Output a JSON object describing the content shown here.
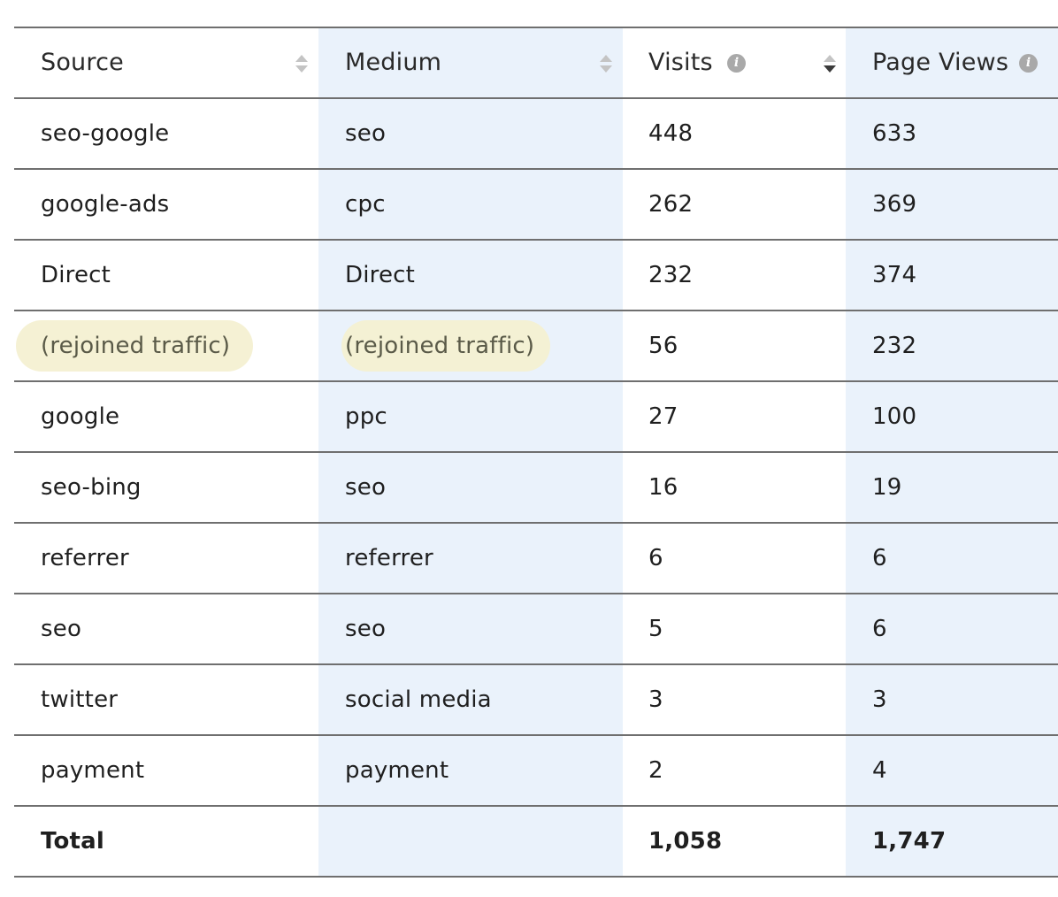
{
  "columns": {
    "source": "Source",
    "medium": "Medium",
    "visits": "Visits",
    "page_views": "Page Views"
  },
  "rows": [
    {
      "source": "seo-google",
      "medium": "seo",
      "visits": "448",
      "page_views": "633"
    },
    {
      "source": "google-ads",
      "medium": "cpc",
      "visits": "262",
      "page_views": "369"
    },
    {
      "source": "Direct",
      "medium": "Direct",
      "visits": "232",
      "page_views": "374"
    },
    {
      "source": "(rejoined traffic)",
      "medium": "(rejoined traffic)",
      "visits": "56",
      "page_views": "232"
    },
    {
      "source": "google",
      "medium": "ppc",
      "visits": "27",
      "page_views": "100"
    },
    {
      "source": "seo-bing",
      "medium": "seo",
      "visits": "16",
      "page_views": "19"
    },
    {
      "source": "referrer",
      "medium": "referrer",
      "visits": "6",
      "page_views": "6"
    },
    {
      "source": "seo",
      "medium": "seo",
      "visits": "5",
      "page_views": "6"
    },
    {
      "source": "twitter",
      "medium": "social media",
      "visits": "3",
      "page_views": "3"
    },
    {
      "source": "payment",
      "medium": "payment",
      "visits": "2",
      "page_views": "4"
    }
  ],
  "total": {
    "label": "Total",
    "visits": "1,058",
    "page_views": "1,747"
  },
  "icons": {
    "sort": "sort-icon",
    "info": "info-icon",
    "info_glyph": "i"
  },
  "colors": {
    "column_shade": "#eaf2fb",
    "highlight": "#f4f0d2",
    "rule": "#6f6f6f"
  }
}
